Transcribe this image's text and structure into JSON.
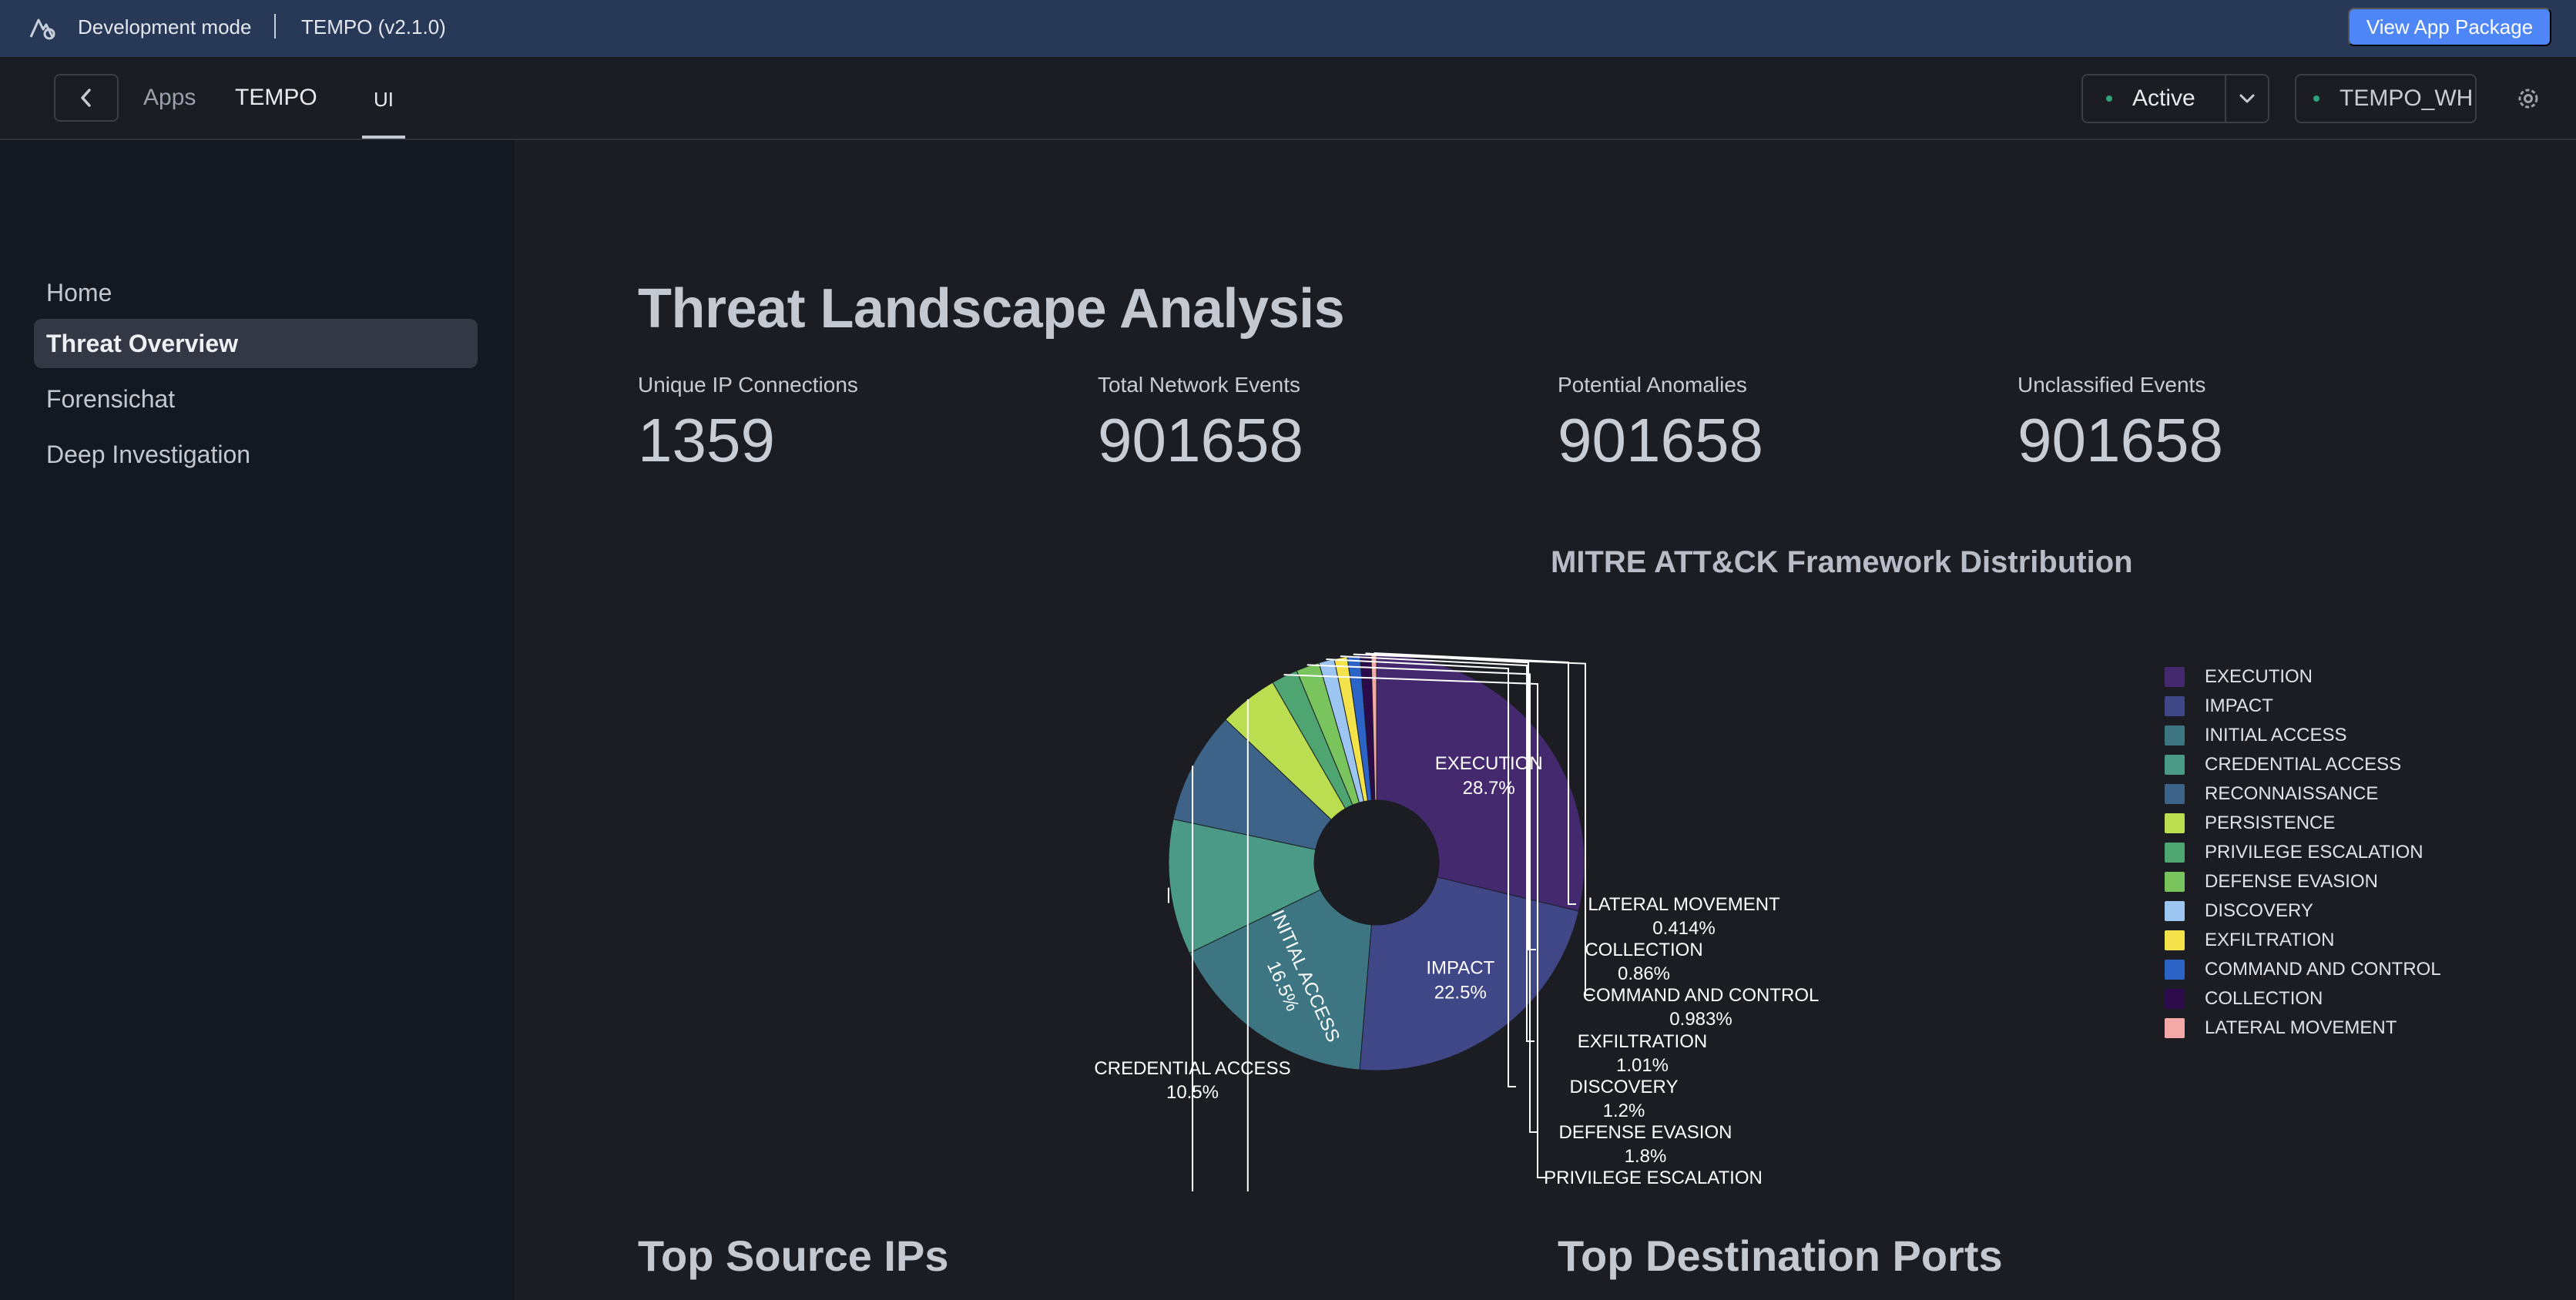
{
  "devbar": {
    "mode": "Development mode",
    "app_version": "TEMPO (v2.1.0)",
    "package_button": "View App Package"
  },
  "header": {
    "crumb_apps": "Apps",
    "crumb_app": "TEMPO",
    "tab": "UI",
    "status": "Active",
    "warehouse": "TEMPO_WH"
  },
  "sidebar": {
    "items": [
      {
        "label": "Home"
      },
      {
        "label": "Threat Overview"
      },
      {
        "label": "Forensichat"
      },
      {
        "label": "Deep Investigation"
      }
    ]
  },
  "page": {
    "title": "Threat Landscape Analysis",
    "metrics": [
      {
        "label": "Unique IP Connections",
        "value": "1359"
      },
      {
        "label": "Total Network Events",
        "value": "901658"
      },
      {
        "label": "Potential Anomalies",
        "value": "901658"
      },
      {
        "label": "Unclassified Events",
        "value": "901658"
      }
    ],
    "sections": {
      "source_ips": "Top Source IPs",
      "dest_ports": "Top Destination Ports"
    }
  },
  "chart_data": {
    "type": "pie",
    "title": "MITRE ATT&CK Framework Distribution",
    "hole": 0.3,
    "legend_position": "right",
    "slices": [
      {
        "label": "EXECUTION",
        "value": 28.7,
        "color": "#45296f"
      },
      {
        "label": "IMPACT",
        "value": 22.5,
        "color": "#3f4787"
      },
      {
        "label": "INITIAL ACCESS",
        "value": 16.5,
        "color": "#3d7682"
      },
      {
        "label": "CREDENTIAL ACCESS",
        "value": 10.5,
        "color": "#4a9a86"
      },
      {
        "label": "RECONNAISSANCE",
        "value": 8.7,
        "color": "#3e6389"
      },
      {
        "label": "PERSISTENCE",
        "value": 4.6,
        "color": "#bade4f"
      },
      {
        "label": "PRIVILEGE ESCALATION",
        "value": 2.04,
        "color": "#4fa571"
      },
      {
        "label": "DEFENSE EVASION",
        "value": 1.8,
        "color": "#79c45d"
      },
      {
        "label": "DISCOVERY",
        "value": 1.2,
        "color": "#9cc6f1"
      },
      {
        "label": "EXFILTRATION",
        "value": 1.01,
        "color": "#f4e24a"
      },
      {
        "label": "COMMAND AND CONTROL",
        "value": 0.983,
        "color": "#2c63c7"
      },
      {
        "label": "COLLECTION",
        "value": 0.86,
        "color": "#2b0b4a"
      },
      {
        "label": "LATERAL MOVEMENT",
        "value": 0.414,
        "color": "#f4a8a8"
      }
    ],
    "inside_labels": [
      {
        "name": "EXECUTION",
        "pct": "28.7%"
      },
      {
        "name": "IMPACT",
        "pct": "22.5%"
      },
      {
        "name": "INITIAL ACCESS",
        "pct": "16.5%"
      }
    ],
    "outside_labels": [
      {
        "name": "CREDENTIAL ACCESS",
        "pct": "10.5%"
      },
      {
        "name": "LATERAL MOVEMENT",
        "pct": "0.414%"
      },
      {
        "name": "COLLECTION",
        "pct": "0.86%"
      },
      {
        "name": "COMMAND AND CONTROL",
        "pct": "0.983%"
      },
      {
        "name": "EXFILTRATION",
        "pct": "1.01%"
      },
      {
        "name": "DISCOVERY",
        "pct": "1.2%"
      },
      {
        "name": "DEFENSE EVASION",
        "pct": "1.8%"
      },
      {
        "name": "PRIVILEGE ESCALATION",
        "pct": ""
      }
    ]
  }
}
